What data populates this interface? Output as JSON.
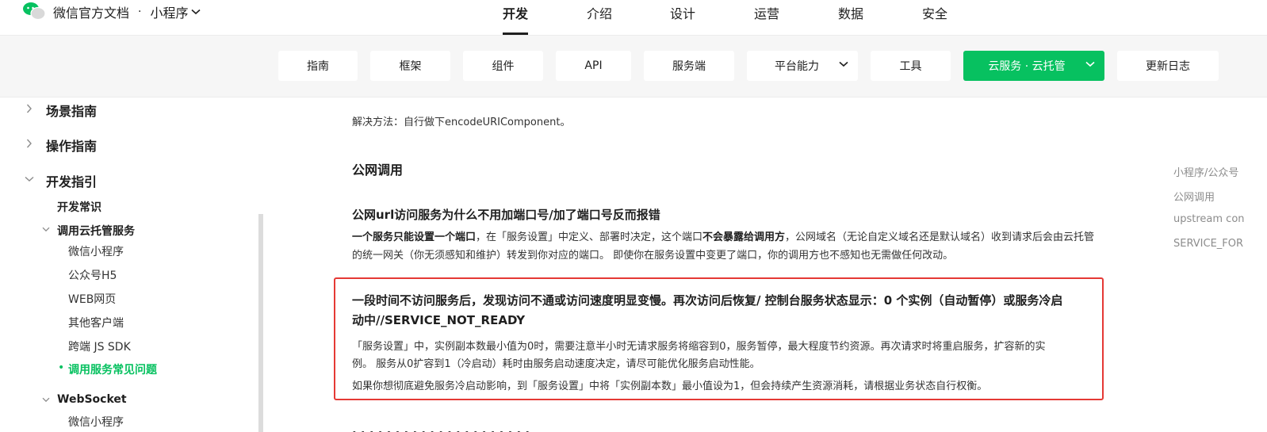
{
  "brand": {
    "site": "微信官方文档",
    "separator": "·",
    "product": "小程序"
  },
  "topnav": {
    "tabs": [
      {
        "label": "开发",
        "active": true
      },
      {
        "label": "介绍",
        "active": false
      },
      {
        "label": "设计",
        "active": false
      },
      {
        "label": "运营",
        "active": false
      },
      {
        "label": "数据",
        "active": false
      },
      {
        "label": "安全",
        "active": false
      }
    ]
  },
  "subnav": {
    "items": [
      {
        "label": "指南"
      },
      {
        "label": "框架"
      },
      {
        "label": "组件"
      },
      {
        "label": "API"
      },
      {
        "label": "服务端"
      },
      {
        "label": "平台能力",
        "dropdown": true
      },
      {
        "label": "工具"
      },
      {
        "label": "云服务 · 云托管",
        "dropdown": true,
        "primary": true
      },
      {
        "label": "更新日志"
      }
    ]
  },
  "sidebar": {
    "items": [
      {
        "label": "场景指南",
        "level": 1,
        "expanded": false
      },
      {
        "label": "操作指南",
        "level": 1,
        "expanded": false
      },
      {
        "label": "开发指引",
        "level": 1,
        "expanded": true
      },
      {
        "label": "开发常识",
        "level": 2
      },
      {
        "label": "调用云托管服务",
        "level": 2,
        "expanded": true
      },
      {
        "label": "微信小程序",
        "level": 3
      },
      {
        "label": "公众号H5",
        "level": 3
      },
      {
        "label": "WEB网页",
        "level": 3
      },
      {
        "label": "其他客户端",
        "level": 3
      },
      {
        "label": "跨端 JS SDK",
        "level": 3
      },
      {
        "label": "调用服务常见问题",
        "level": 3,
        "active": true
      },
      {
        "label": "WebSocket",
        "level": 2,
        "expanded": true
      },
      {
        "label": "微信小程序",
        "level": 3
      }
    ]
  },
  "content": {
    "prev_solution": "解决方法：自行做下encodeURIComponent。",
    "section_title": "公网调用",
    "q1": {
      "title": "公网url访问服务为什么不用加端口号/加了端口号反而报错",
      "p_bold1": "一个服务只能设置一个端口",
      "p_text1": "，在「服务设置」中定义、部署时决定，这个端口",
      "p_bold2": "不会暴露给调用方",
      "p_text2": "，公网域名（无论自定义域名还是默认域名）收到请求后会由云托管的统一网关（你无须感知和维护）转发到你对应的端口。 即使你在服务设置中变更了端口，你的调用方也不感知也无需做任何改动。"
    },
    "q2": {
      "title_line1": "一段时间不访问服务后，发现访问不通或访问速度明显变慢。再次访问后恢复/ 控制台服务状态显示：0 个实例（自动暂停）或服务冷启",
      "title_line2": "动中//SERVICE_NOT_READY",
      "p1_line1": "「服务设置」中，实例副本数最小值为0时，需要注意半小时无请求服务将缩容到0，服务暂停，最大程度节约资源。再次请求时将重启服务，扩容新的实",
      "p1_line2": "例。 服务从0扩容到1（冷启动）耗时由服务启动速度决定，请尽可能优化服务启动性能。",
      "p2": "如果你想彻底避免服务冷启动影响，到「服务设置」中将「实例副本数」最小值设为1，但会持续产生资源消耗，请根据业务状态自行权衡。"
    }
  },
  "toc": {
    "items": [
      "小程序/公众号",
      "公网调用",
      "upstream con",
      "SERVICE_FOR"
    ]
  },
  "colors": {
    "accent": "#07c160",
    "highlight_border": "#e53935",
    "toc_text": "#8c8c8c"
  },
  "icons": {
    "logo": "wechat-logo-icon",
    "dropdown": "chevron-down-icon",
    "collapsed": "chevron-right-icon"
  }
}
